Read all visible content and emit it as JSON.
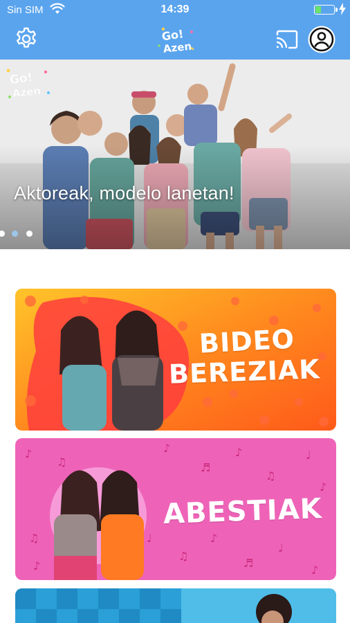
{
  "status_bar": {
    "carrier": "Sin SIM",
    "time": "14:39",
    "battery_level": 0.3,
    "battery_color": "#6be36b"
  },
  "app_bar": {
    "background": "#5aa4ee",
    "settings_icon": "gear-icon",
    "logo_text": "Go! Azen",
    "cast_icon": "cast-icon",
    "profile_icon": "user-circle-icon"
  },
  "hero": {
    "title": "Aktoreak, modelo lanetan!",
    "slides": 3,
    "active_slide": 1,
    "logo_text": "Go! Azen"
  },
  "categories": [
    {
      "line1": "BIDEO",
      "line2": "BEREZIAK",
      "color": "#f76a1c"
    },
    {
      "line1": "ABESTIAK",
      "color": "#ec5bb3"
    },
    {
      "color": "#2a9fd8"
    }
  ]
}
